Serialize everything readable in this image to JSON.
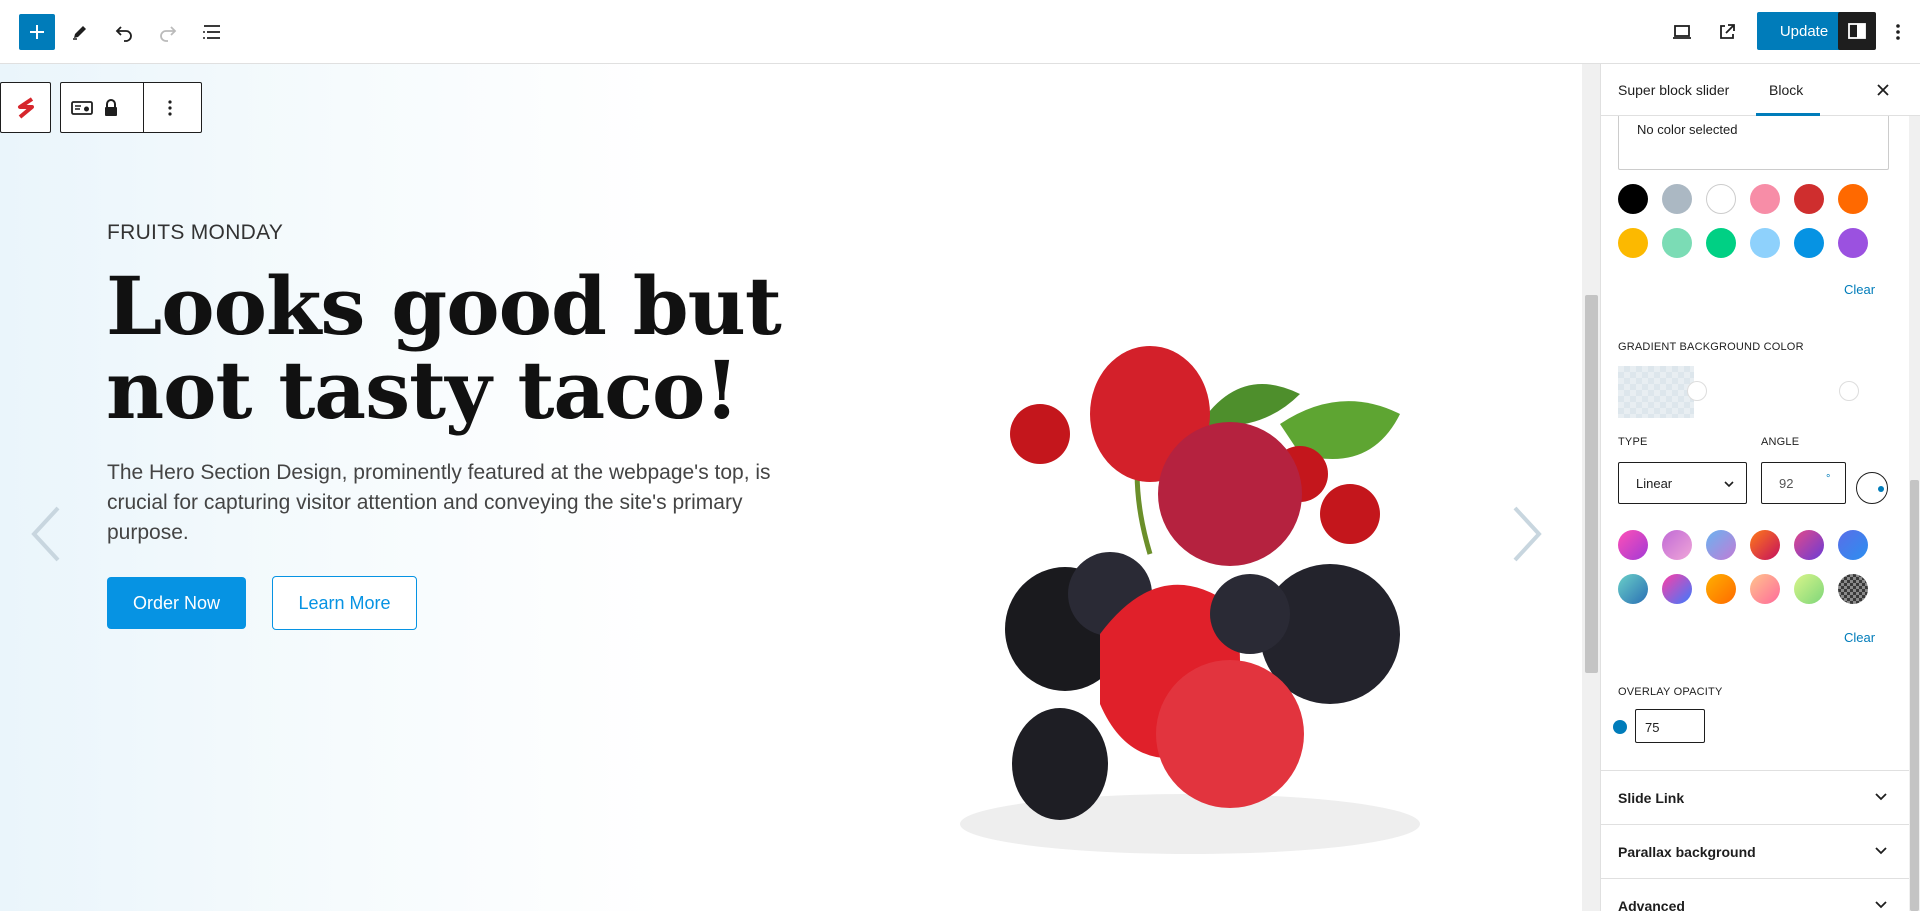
{
  "toolbar": {
    "add_label": "+",
    "update_label": "Update"
  },
  "block_toolbar": {
    "more_label": "⋮"
  },
  "hero": {
    "eyebrow": "FRUITS MONDAY",
    "headline": "Looks good but not tasty taco!",
    "description": "The Hero Section Design, prominently featured at the webpage's top, is crucial for capturing visitor attention and conveying the site's primary purpose.",
    "primary_button": "Order Now",
    "secondary_button": "Learn More"
  },
  "sidebar": {
    "tabs": [
      {
        "label": "Super block slider"
      },
      {
        "label": "Block"
      }
    ],
    "active_tab": "Block",
    "color_picker": {
      "value_text": "No color selected",
      "swatches": [
        "#000000",
        "#abb8c3",
        "#ffffff",
        "#f78da7",
        "#cf2e2e",
        "#ff6900",
        "#fcb900",
        "#7bdcb5",
        "#00d084",
        "#8ed1fc",
        "#0693e3",
        "#9b51e0"
      ],
      "clear_label": "Clear"
    },
    "gradient": {
      "label": "GRADIENT BACKGROUND COLOR",
      "type_label": "TYPE",
      "type_value": "Linear",
      "angle_label": "ANGLE",
      "angle_value": "92",
      "angle_unit": "°",
      "presets": [
        "linear-gradient(135deg,#ff4fb6,#a23ad6)",
        "linear-gradient(135deg,#c06ad6,#f0a6d8)",
        "linear-gradient(135deg,#6ab3f0,#c27bd6)",
        "linear-gradient(135deg,#ff7a18,#c4105e)",
        "linear-gradient(135deg,#e24a8a,#6a3bd6)",
        "linear-gradient(135deg,#5a6ee8,#2b8ff0)",
        "linear-gradient(135deg,#6ad0c8,#2a6fb4)",
        "linear-gradient(135deg,#ff3ea5,#3a7bff)",
        "linear-gradient(135deg,#ffb000,#ff6a00)",
        "linear-gradient(135deg,#ffc48c,#ff6a9b)",
        "linear-gradient(135deg,#d9f58a,#7ed67a)",
        "repeating-conic-gradient(#3a3a3a 0 25%,#8a8a8a 0 50%)"
      ],
      "clear_label": "Clear"
    },
    "overlay": {
      "label": "OVERLAY OPACITY",
      "value": "75"
    },
    "panels": [
      {
        "label": "Slide Link"
      },
      {
        "label": "Parallax background"
      },
      {
        "label": "Advanced"
      }
    ]
  }
}
